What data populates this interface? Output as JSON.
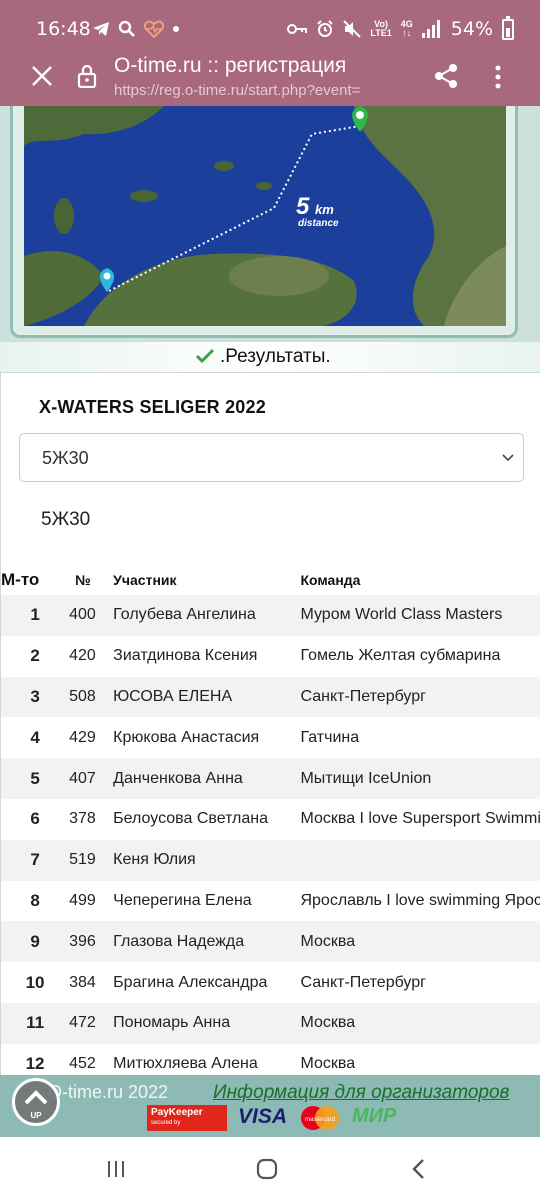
{
  "status_bar": {
    "time": "16:48",
    "volte_top": "Vo)",
    "volte_bottom": "LTE1",
    "network_top": "4G",
    "network_bottom": "↑↓",
    "battery": "54%"
  },
  "browser": {
    "title": "O-time.ru :: регистрация",
    "url": "https://reg.o-time.ru/start.php?event="
  },
  "map": {
    "distance_value": "5",
    "distance_unit": "km",
    "distance_caption": "distance",
    "colors": {
      "water": "#1b3f9a",
      "land": "#4d6a3a",
      "route": "#ffffff",
      "start_pin": "#2fb7e0",
      "finish_pin": "#2cb84a"
    }
  },
  "results_link": ".Результаты.",
  "event": {
    "title": "X-WATERS SELIGER 2022",
    "selected_group": "5Ж30",
    "group_label": "5Ж30"
  },
  "table": {
    "headers": {
      "place": "М-то",
      "number": "№",
      "name": "Участник",
      "team": "Команда"
    },
    "rows": [
      {
        "place": "1",
        "number": "400",
        "name": "Голубева Ангелина",
        "team": "Муром World Class Masters"
      },
      {
        "place": "2",
        "number": "420",
        "name": "Зиатдинова Ксения",
        "team": "Гомель Желтая субмарина"
      },
      {
        "place": "3",
        "number": "508",
        "name": "ЮСОВА ЕЛЕНА",
        "team": "Санкт-Петербург"
      },
      {
        "place": "4",
        "number": "429",
        "name": "Крюкова Анастасия",
        "team": "Гатчина"
      },
      {
        "place": "5",
        "number": "407",
        "name": "Данченкова Анна",
        "team": "Мытищи IceUnion"
      },
      {
        "place": "6",
        "number": "378",
        "name": "Белоусова Светлана",
        "team": "Москва I love Supersport Swimming"
      },
      {
        "place": "7",
        "number": "519",
        "name": "Кеня Юлия",
        "team": ""
      },
      {
        "place": "8",
        "number": "499",
        "name": "Чеперегина Елена",
        "team": "Ярославль I love swimming Ярославль"
      },
      {
        "place": "9",
        "number": "396",
        "name": "Глазова Надежда",
        "team": "Москва"
      },
      {
        "place": "10",
        "number": "384",
        "name": "Брагина Александра",
        "team": "Санкт-Петербург"
      },
      {
        "place": "11",
        "number": "472",
        "name": "Пономарь Анна",
        "team": "Москва"
      },
      {
        "place": "12",
        "number": "452",
        "name": "Митюхляева Алена",
        "team": "Москва"
      }
    ]
  },
  "footer": {
    "copyright": "O-time.ru 2022",
    "organizer_link": "Информация для организаторов",
    "up_label": "UP",
    "payments": {
      "paykeeper": "PayKeeper",
      "paykeeper_sub": "secured by",
      "visa": "VISA",
      "mastercard": "mastercard",
      "mir": "МИР"
    }
  }
}
